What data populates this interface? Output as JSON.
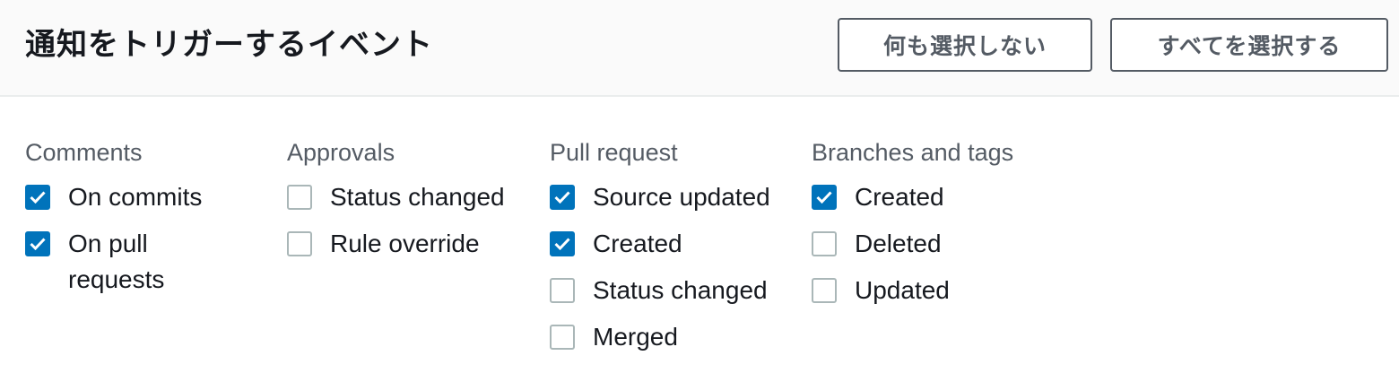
{
  "header": {
    "title": "通知をトリガーするイベント",
    "select_none_label": "何も選択しない",
    "select_all_label": "すべてを選択する"
  },
  "colors": {
    "accent": "#0073bb",
    "text": "#16191f",
    "muted": "#545b64",
    "header_bg": "#fafafa"
  },
  "columns": [
    {
      "heading": "Comments",
      "items": [
        {
          "label": "On commits",
          "checked": true
        },
        {
          "label": "On pull requests",
          "checked": true
        }
      ]
    },
    {
      "heading": "Approvals",
      "items": [
        {
          "label": "Status changed",
          "checked": false
        },
        {
          "label": "Rule override",
          "checked": false
        }
      ]
    },
    {
      "heading": "Pull request",
      "items": [
        {
          "label": "Source updated",
          "checked": true
        },
        {
          "label": "Created",
          "checked": true
        },
        {
          "label": "Status changed",
          "checked": false
        },
        {
          "label": "Merged",
          "checked": false
        }
      ]
    },
    {
      "heading": "Branches and tags",
      "items": [
        {
          "label": "Created",
          "checked": true
        },
        {
          "label": "Deleted",
          "checked": false
        },
        {
          "label": "Updated",
          "checked": false
        }
      ]
    }
  ]
}
